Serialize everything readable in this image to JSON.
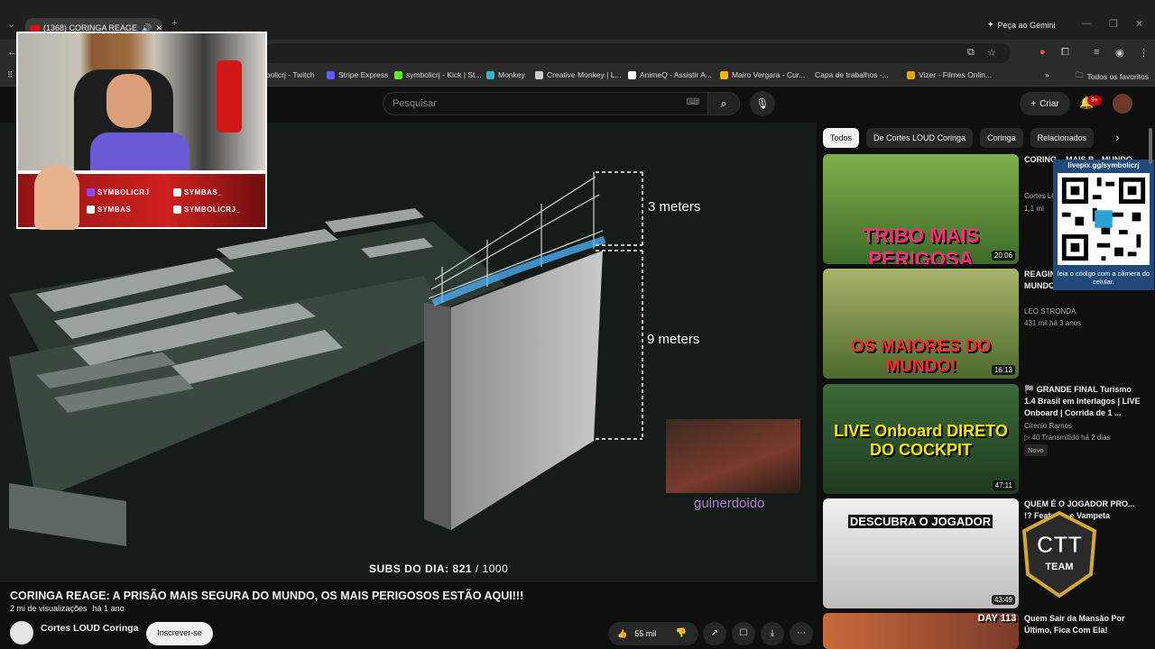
{
  "browser": {
    "tab_title": "(1368) CORINGA REAGE: A",
    "gemini_label": "Peça ao Gemini",
    "bookmarks": [
      {
        "label": "nbolicrj - Twitch",
        "color": "#9146ff"
      },
      {
        "label": "Stripe Express",
        "color": "#635bff"
      },
      {
        "label": "symbolicrj - Kick | St...",
        "color": "#53fc18"
      },
      {
        "label": "Monkey",
        "color": "#30b5c9"
      },
      {
        "label": "Creative Monkey | L...",
        "color": "#cccccc"
      },
      {
        "label": "AnimeQ - Assistir A...",
        "color": "#ffffff"
      },
      {
        "label": "Mairo Vergara - Cur...",
        "color": "#f2b705"
      },
      {
        "label": "Capa de trabalhos -...",
        "color": "#888888"
      },
      {
        "label": "Vizer - Filmes Onlin...",
        "color": "#e5a50a"
      }
    ],
    "all_bookmarks": "Todos os favoritos"
  },
  "header": {
    "search_placeholder": "Pesquisar",
    "create_label": "Criar",
    "notif_count": "9+"
  },
  "player": {
    "label_top": "3 meters",
    "label_bottom": "9 meters",
    "subs_label": "SUBS DO DIA:",
    "subs_value": "821",
    "subs_goal": "/ 1000",
    "clip_user": "guinerdoido",
    "cam_social": {
      "twitch": "SYMBOLICRJ",
      "tiktok": "SYMBAS_",
      "youtube": "SYMBAS",
      "instagram": "SYMBOLICRJ_"
    }
  },
  "video": {
    "title": "CORINGA REAGE: A PRISÃO MAIS SEGURA DO MUNDO, OS MAIS PERIGOSOS ESTÃO AQUI!!!",
    "views": "2 mi de visualizações",
    "age": "há 1 ano",
    "channel": "Cortes LOUD Coringa",
    "subscribe_label": "Inscrever-se",
    "likes": "55 mil"
  },
  "sidebar": {
    "chips": [
      "Todos",
      "De Cortes LOUD Coringa",
      "Coringa",
      "Relacionados"
    ],
    "recs": [
      {
        "title": "CORING... MAIS P... MUNDO...",
        "channel": "Cortes LO...",
        "stats": "1,1 mi",
        "duration": "20:06",
        "thumb_text": "TRIBO MAIS PERIGOSA",
        "thumb_color": "#3d6b2a",
        "text_color": "#ff2d7a"
      },
      {
        "title": "REAGIN... COM M... DO MUNDO! - LEO STRONDA",
        "channel": "LEO STRONDA",
        "stats": "431 mil   há 3 anos",
        "duration": "16:13",
        "thumb_text": "OS MAIORES DO MUNDO!",
        "thumb_color": "#6b8a3c",
        "text_color": "#ff2a2a"
      },
      {
        "title": "🏁 GRANDE FINAL Turismo 1.4 Brasil em Interlagos | LIVE Onboard | Corrida de 1 ...",
        "channel": "Cirenio Ramos",
        "stats": "▷ 40   Transmitido há 2 dias",
        "badge": "Novo",
        "duration": "47:11",
        "thumb_text": "LIVE Onboard DIRETO DO COCKPIT",
        "thumb_color": "#2a4a2a",
        "text_color": "#f5e400"
      },
      {
        "title": "QUEM É O JOGADOR PRO... !? Feat. E... e Vampeta",
        "channel": "",
        "stats": "",
        "duration": "43:49",
        "thumb_text": "DESCUBRA O JOGADOR",
        "thumb_color": "#d8d8d8",
        "text_color": "#ffffff"
      },
      {
        "title": "Quem Sair da Mansão Por Último, Fica Com Ela!",
        "channel": "",
        "stats": "",
        "duration": "",
        "thumb_text": "DAY 113",
        "thumb_color": "#a34a2a",
        "text_color": "#ffffff"
      }
    ],
    "qr_url": "livepix.gg/symbolicrj",
    "qr_caption": "leia o código com a câmera do celular.",
    "ctt_logo": "CTT",
    "ctt_team": "TEAM"
  },
  "colors": {
    "yt_red": "#ff0000",
    "background": "#0f0f0f",
    "social_red": "#cf1f1f",
    "clip_user": "#b27bd8"
  }
}
